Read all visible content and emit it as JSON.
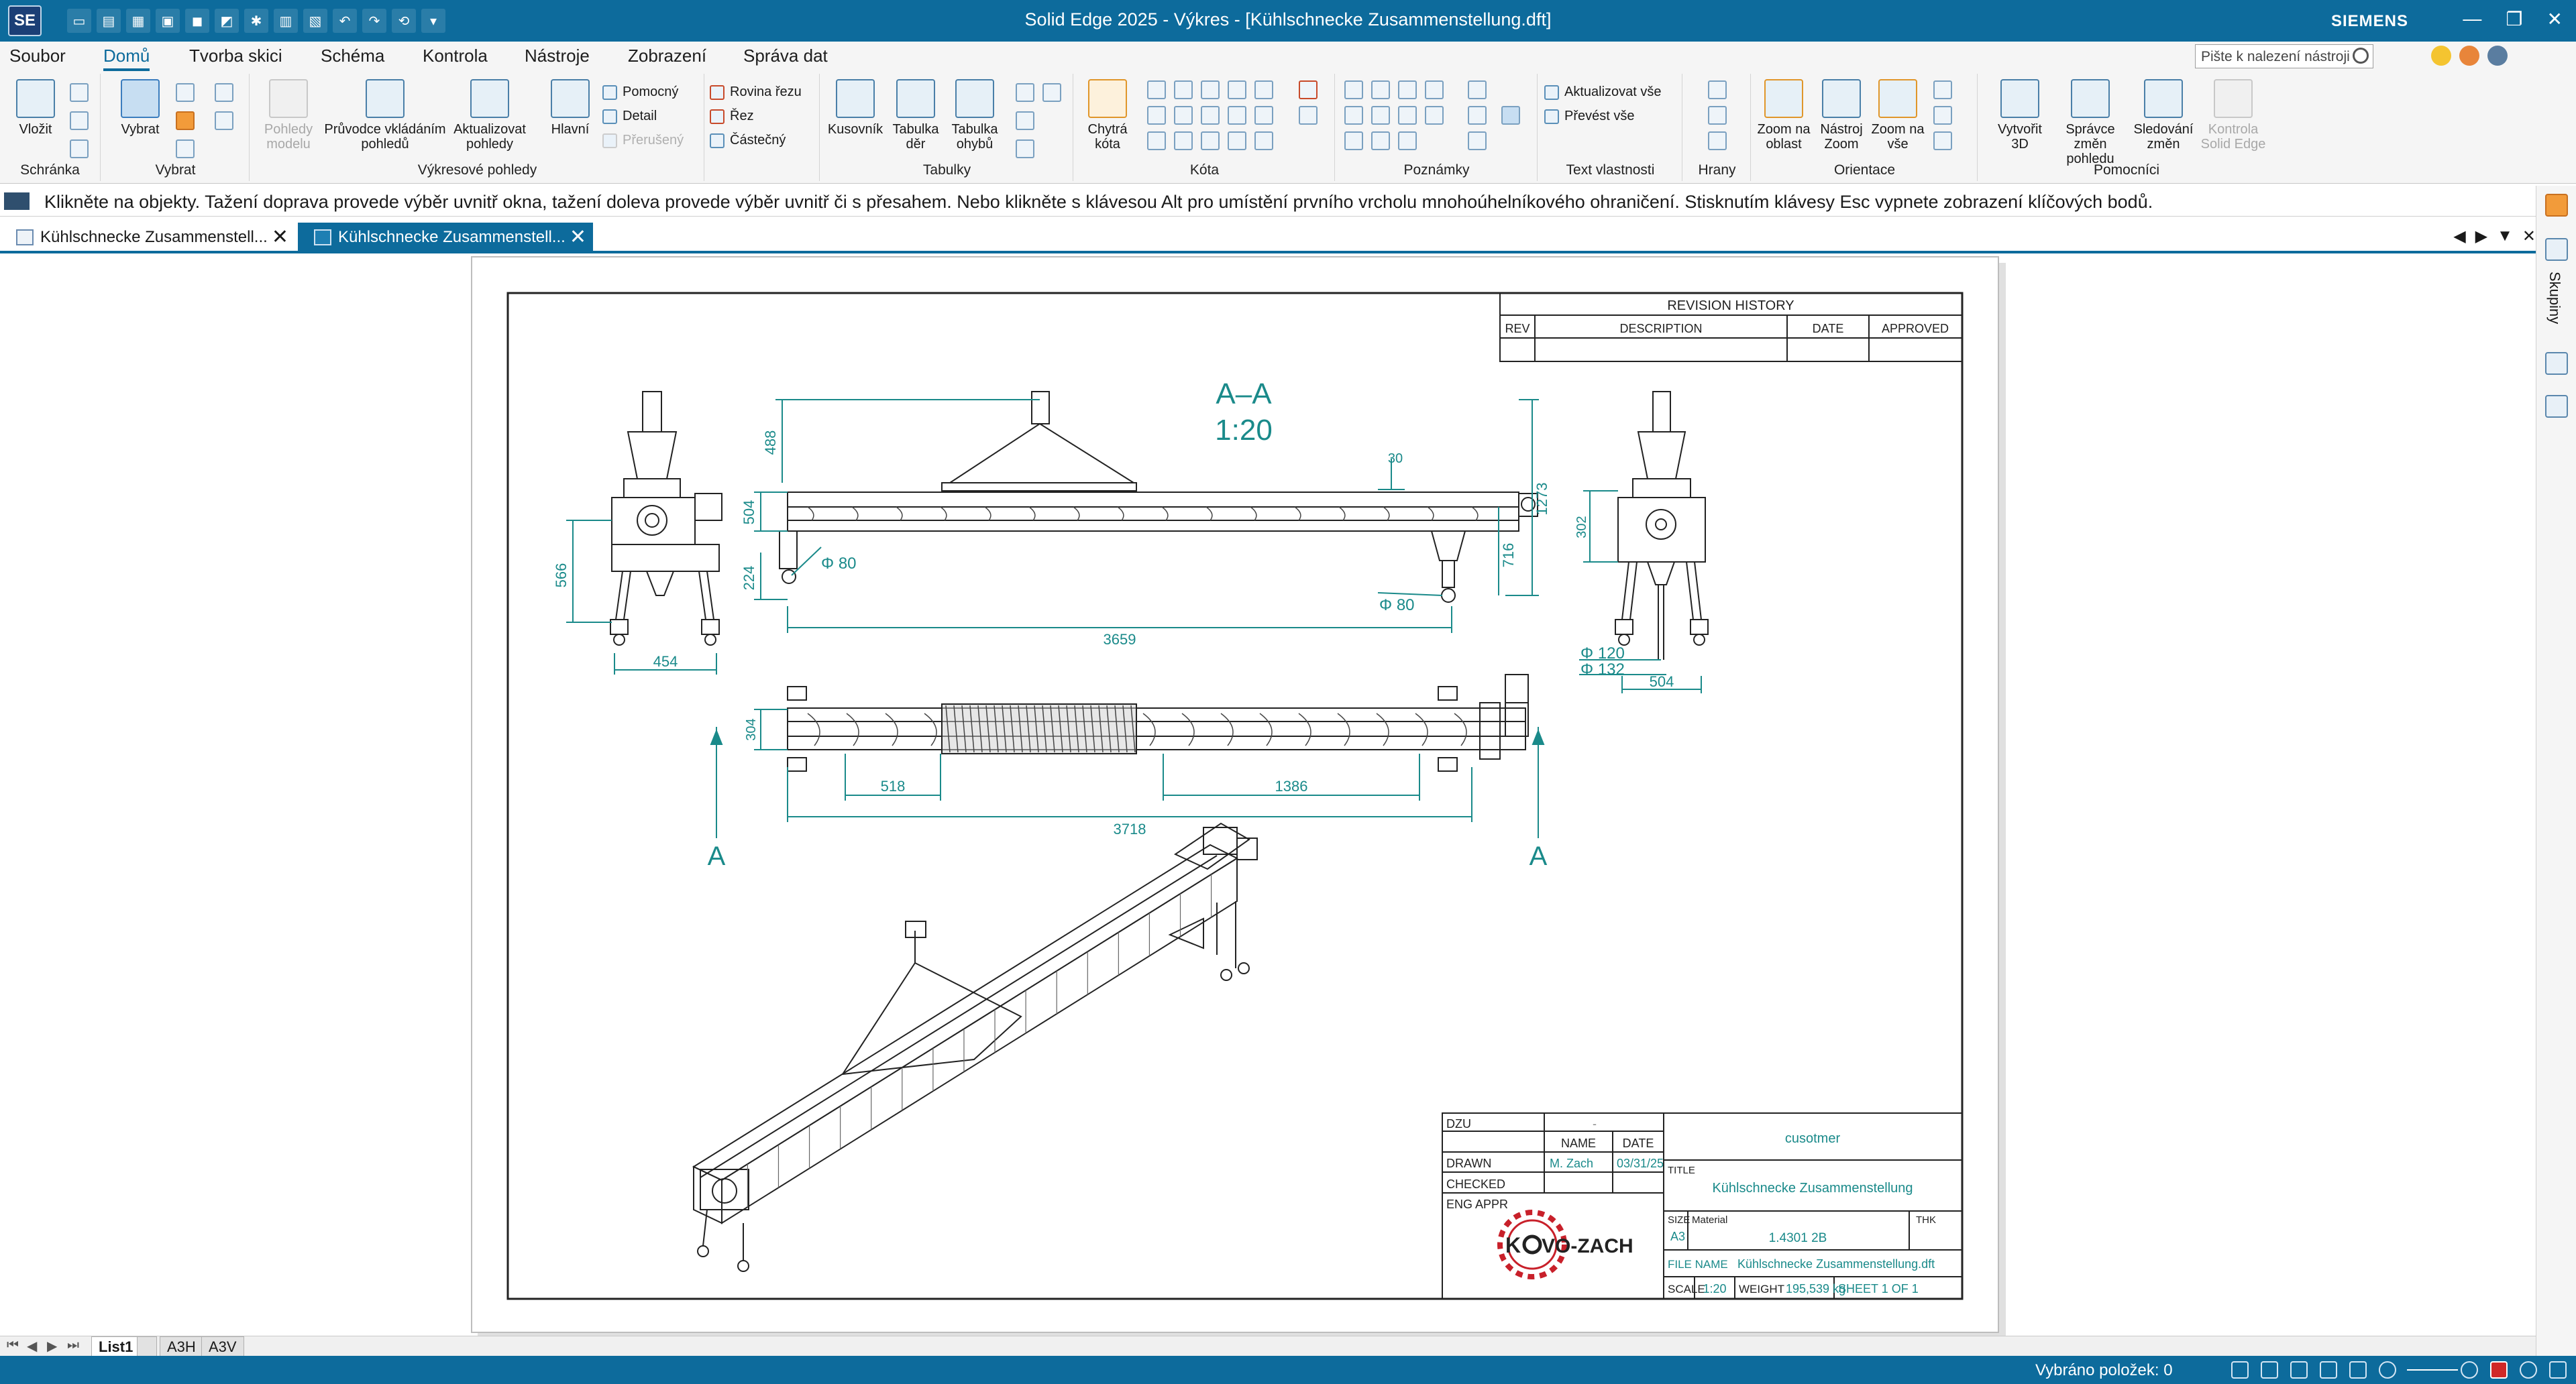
{
  "app": {
    "logo": "SE",
    "title": "Solid Edge 2025 - Výkres - [Kühlschnecke Zusammenstellung.dft]",
    "brand": "SIEMENS",
    "window_buttons": [
      "—",
      "❐",
      "✕"
    ]
  },
  "menu": {
    "tabs": [
      "Soubor",
      "Domů",
      "Tvorba skici",
      "Schéma",
      "Kontrola",
      "Nástroje",
      "Zobrazení",
      "Správa dat"
    ],
    "active": "Domů",
    "search_placeholder": "Pište k nalezení nástroji"
  },
  "ribbon": {
    "groups": {
      "schranka": "Schránka",
      "vybrat": "Vybrat",
      "vykresove_pohledy": "Výkresové pohledy",
      "tabulky": "Tabulky",
      "kota": "Kóta",
      "poznamky": "Poznámky",
      "text_vlastnosti": "Text vlastnosti",
      "hrany": "Hrany",
      "orientace": "Orientace",
      "pomocnici": "Pomocníci"
    },
    "buttons": {
      "vlozit": "Vložit",
      "vybrat": "Vybrat",
      "pohledy_modelu": "Pohledy modelu",
      "pruvodce": "Průvodce vkládáním pohledů",
      "aktualizovat_pohledy": "Aktualizovat pohledy",
      "hlavni": "Hlavní",
      "pomocny": "Pomocný",
      "detail": "Detail",
      "preruseny": "Přerušený",
      "rovina_rezu": "Rovina řezu",
      "rez": "Řez",
      "castecny": "Částečný",
      "kusovnik": "Kusovník",
      "tabulka_der": "Tabulka děr",
      "tabulka_ohybu": "Tabulka ohybů",
      "chytra_kota": "Chytrá kóta",
      "aktualizovat_vse": "Aktualizovat vše",
      "prevest_vse": "Převést vše",
      "zoom_na_oblast": "Zoom na oblast",
      "nastroj_zoom": "Nástroj Zoom",
      "zoom_na_vse": "Zoom na vše",
      "vytvorit_3d": "Vytvořit 3D",
      "spravce_zmen": "Správce změn pohledu",
      "sledovani_zmen": "Sledování změn",
      "kontrola_se": "Kontrola Solid Edge"
    }
  },
  "prompt": "Klikněte na objekty. Tažení doprava provede výběr uvnitř okna, tažení doleva provede výběr uvnitř či s přesahem. Nebo klikněte s klávesou Alt pro umístění prvního vrcholu mnohoúhelníkového ohraničení. Stisknutím klávesy Esc vypnete zobrazení klíčových bodů.",
  "doc_tabs": [
    {
      "label": "Kühlschnecke Zusammenstell...",
      "active": false
    },
    {
      "label": "Kühlschnecke Zusammenstell...",
      "active": true
    }
  ],
  "side_panel": {
    "label": "Skupiny"
  },
  "drawing": {
    "revision": {
      "title": "REVISION HISTORY",
      "cols": [
        "REV",
        "DESCRIPTION",
        "DATE",
        "APPROVED"
      ]
    },
    "section_title": "A–A",
    "section_scale": "1:20",
    "section_marks": [
      "A",
      "A"
    ],
    "dims_front": [
      "488",
      "504",
      "30",
      "1273",
      "716",
      "224",
      "3659"
    ],
    "diam_labels": [
      "Φ 80",
      "Φ 80"
    ],
    "dims_left": [
      "566",
      "454"
    ],
    "dims_right": [
      "302",
      "Φ 120",
      "Φ 132",
      "504"
    ],
    "dims_top": [
      "304",
      "518",
      "1386",
      "3718"
    ],
    "title_block": {
      "dzu": "DZU",
      "dash": "-",
      "name_col": "NAME",
      "date_col": "DATE",
      "drawn": "DRAWN",
      "drawn_name": "M. Zach",
      "drawn_date": "03/31/25",
      "checked": "CHECKED",
      "eng_appr": "ENG APPR",
      "company": "cusotmer",
      "title_label": "TITLE",
      "title_value": "Kühlschnecke Zusammenstellung",
      "size_label": "SIZE",
      "size_value": "A3",
      "material_label": "Material",
      "material_value": "1.4301 2B",
      "thk": "THK",
      "file_name_label": "FILE NAME",
      "file_name": "Kühlschnecke Zusammenstellung.dft",
      "scale_label": "SCALE",
      "scale_value": "1:20",
      "weight_label": "WEIGHT",
      "weight_value": "195,539 kg",
      "sheet": "SHEET 1 OF 1",
      "logo_left": "K",
      "logo_right": "VO-ZACH"
    }
  },
  "sheet_tabs": [
    {
      "label": "List1",
      "active": true
    },
    {
      "label": "A3H",
      "active": false
    },
    {
      "label": "A3V",
      "active": false
    }
  ],
  "status": {
    "text": "Vybráno položek: 0"
  },
  "colors": {
    "accent": "#0d6b9c",
    "dim": "#1a8a8a",
    "line": "#222222",
    "logo_red": "#c8202a"
  }
}
